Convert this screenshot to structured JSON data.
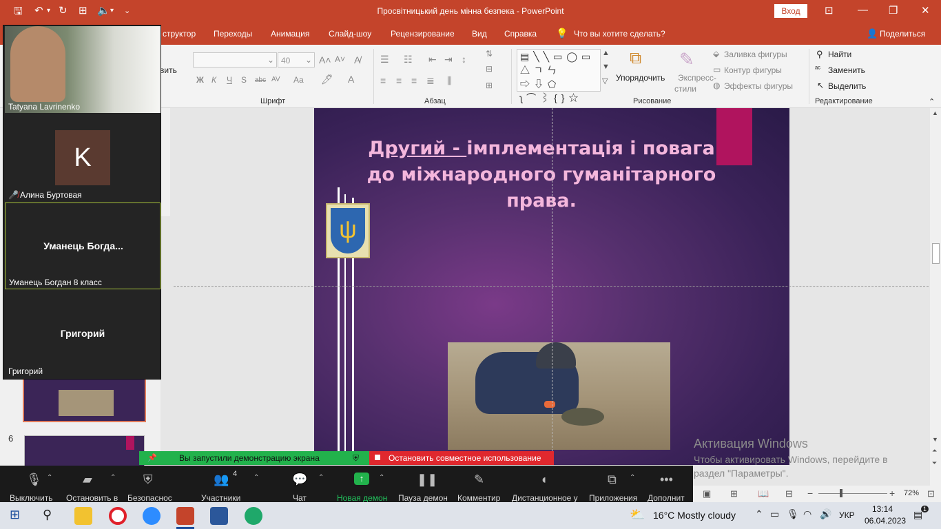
{
  "window": {
    "title": "Просвітницький день мінна безпека  -  PowerPoint",
    "signin": "Вход"
  },
  "tabs": [
    "структор",
    "Переходы",
    "Анимация",
    "Слайд-шоу",
    "Рецензирование",
    "Вид",
    "Справка"
  ],
  "tell_me": "Что вы хотите сделать?",
  "share": "Поделиться",
  "ribbon": {
    "left_cut": "вить",
    "font_size": "40",
    "groups": {
      "font": "Шрифт",
      "paragraph": "Абзац",
      "drawing": "Рисование",
      "editing": "Редактирование"
    },
    "arrange": "Упорядочить",
    "quick_styles_1": "Экспресс-",
    "quick_styles_2": "стили",
    "shape_fill": "Заливка фигуры",
    "shape_outline": "Контур фигуры",
    "shape_effects": "Эффекты фигуры",
    "find": "Найти",
    "replace": "Заменить",
    "select": "Выделить"
  },
  "slide": {
    "title_underlined": "Другий - ",
    "title_rest_1": "імплементація і повага",
    "title_line2": "до міжнародного гуманітарного",
    "title_line3": "права."
  },
  "thumbs": {
    "next_number": "6"
  },
  "zoom": {
    "participants": [
      {
        "name": "Tatyana Lavrinenko"
      },
      {
        "name": "Алина Буртовая",
        "initial": "K"
      },
      {
        "name": "Уманець Богдан 8 класс",
        "display": "Уманець  Богда..."
      },
      {
        "name": "Григорий",
        "display": "Григорий"
      }
    ],
    "share_notice": "Вы запустили демонстрацию экрана",
    "stop_share": "Остановить совместное использование",
    "toolbar": [
      "Выключить",
      "Остановить в",
      "Безопаснос",
      "Участники",
      "Чат",
      "Новая демон",
      "Пауза демон",
      "Комментир",
      "Дистанционное у",
      "Приложения",
      "Дополнит"
    ],
    "participants_count": "4"
  },
  "activation": {
    "title": "Активация Windows",
    "text": "Чтобы активировать Windows, перейдите в раздел \"Параметры\"."
  },
  "statusbar": {
    "zoom": "72%"
  },
  "taskbar": {
    "weather": "16°C  Mostly cloudy",
    "lang": "УКР",
    "time": "13:14",
    "date": "06.04.2023",
    "notif": "1"
  }
}
